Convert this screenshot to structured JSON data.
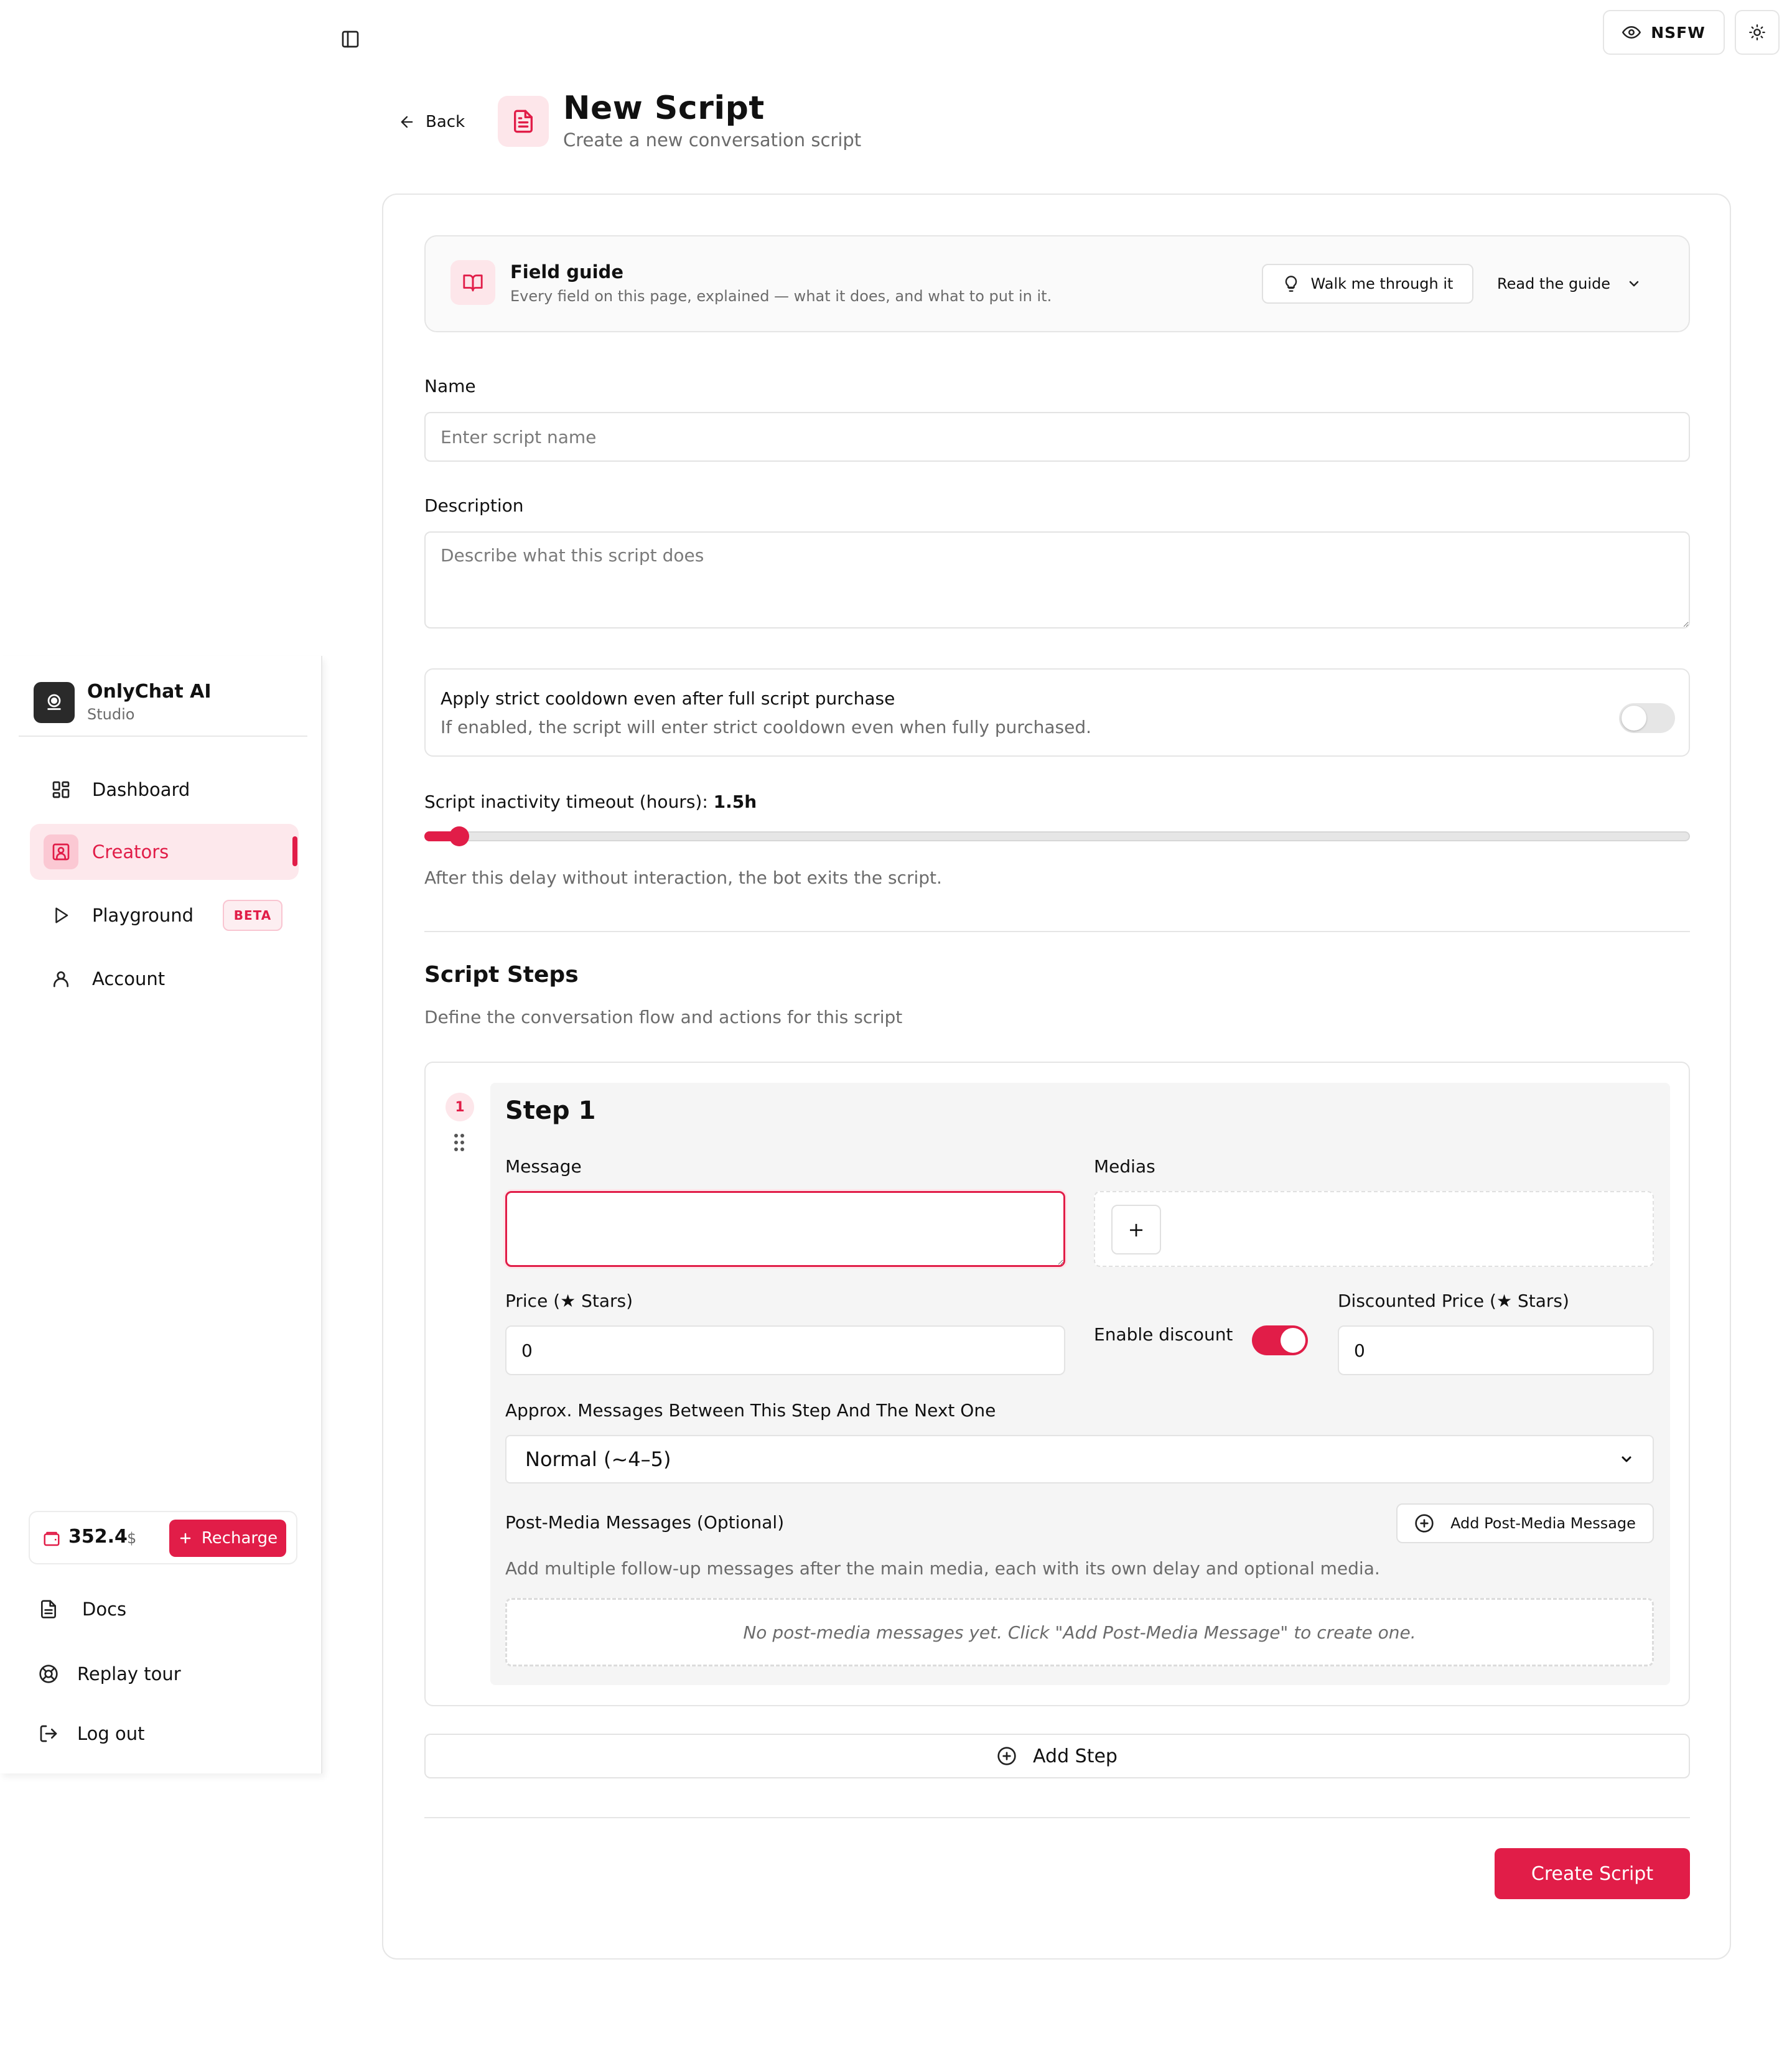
{
  "topbar": {
    "nsfw_label": "NSFW"
  },
  "header": {
    "back_label": "Back",
    "title": "New Script",
    "subtitle": "Create a new conversation script"
  },
  "field_guide": {
    "title": "Field guide",
    "description": "Every field on this page, explained — what it does, and what to put in it.",
    "walk_label": "Walk me through it",
    "read_label": "Read the guide"
  },
  "form": {
    "name_label": "Name",
    "name_placeholder": "Enter script name",
    "name_value": "",
    "description_label": "Description",
    "description_placeholder": "Describe what this script does",
    "cooldown_title": "Apply strict cooldown even after full script purchase",
    "cooldown_desc": "If enabled, the script will enter strict cooldown even when fully purchased.",
    "cooldown_enabled": false,
    "timeout_label": "Script inactivity timeout (hours):",
    "timeout_value": "1.5h",
    "timeout_help": "After this delay without interaction, the bot exits the script."
  },
  "steps_section": {
    "title": "Script Steps",
    "description": "Define the conversation flow and actions for this script"
  },
  "step": {
    "number": "1",
    "title": "Step 1",
    "message_label": "Message",
    "message_value": "",
    "medias_label": "Medias",
    "media_add": "+",
    "price_label": "Price (★ Stars)",
    "price_value": "0",
    "discount_label": "Enable discount",
    "discount_enabled": true,
    "discounted_label": "Discounted Price (★ Stars)",
    "discounted_value": "0",
    "approx_label": "Approx. Messages Between This Step And The Next One",
    "approx_value": "Normal (~4–5)",
    "postmedia_label": "Post-Media Messages (Optional)",
    "postmedia_button": "Add Post-Media Message",
    "postmedia_help": "Add multiple follow-up messages after the main media, each with its own delay and optional media.",
    "postmedia_empty": "No post-media messages yet. Click \"Add Post-Media Message\" to create one."
  },
  "actions": {
    "add_step": "Add Step",
    "create": "Create Script"
  },
  "sidebar": {
    "brand_name": "OnlyChat AI",
    "brand_sub": "Studio",
    "items": [
      {
        "label": "Dashboard",
        "icon": "dashboard-icon"
      },
      {
        "label": "Creators",
        "icon": "creators-icon",
        "active": true
      },
      {
        "label": "Playground",
        "icon": "play-icon",
        "badge": "BETA"
      },
      {
        "label": "Account",
        "icon": "user-icon"
      }
    ],
    "wallet_amount": "352.4",
    "wallet_currency": "$",
    "recharge_label": "Recharge",
    "footer": [
      {
        "label": "Docs",
        "icon": "docs-icon"
      },
      {
        "label": "Replay tour",
        "icon": "lifebuoy-icon"
      },
      {
        "label": "Log out",
        "icon": "logout-icon"
      }
    ]
  },
  "colors": {
    "accent": "#e11d48",
    "accent_soft": "#fde6ea",
    "muted_text": "#6b6b6b",
    "border": "#e5e5e5"
  }
}
